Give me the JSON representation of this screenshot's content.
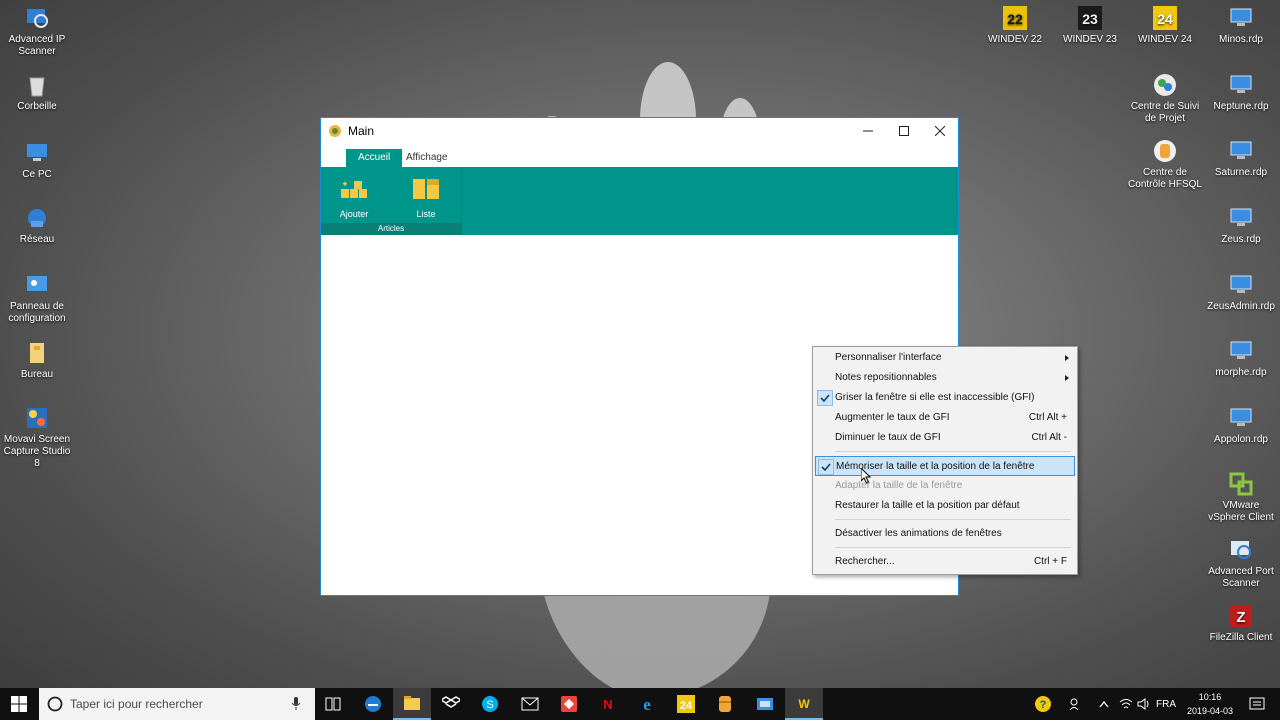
{
  "desktop_left": [
    {
      "label": "Advanced IP Scanner",
      "icon": "advanced-ip-scanner-icon"
    },
    {
      "label": "Corbeille",
      "icon": "recycle-bin-icon"
    },
    {
      "label": "Ce PC",
      "icon": "computer-icon"
    },
    {
      "label": "Réseau",
      "icon": "network-icon"
    },
    {
      "label": "Panneau de configuration",
      "icon": "control-panel-icon"
    },
    {
      "label": "Bureau",
      "icon": "folder-icon"
    },
    {
      "label": "Movavi Screen Capture Studio 8",
      "icon": "movavi-icon"
    }
  ],
  "desktop_right": [
    {
      "label": "WINDEV 22",
      "icon": "windev-22-icon"
    },
    {
      "label": "WINDEV 23",
      "icon": "windev-23-icon"
    },
    {
      "label": "WINDEV 24",
      "icon": "windev-24-icon"
    },
    {
      "label": "Minos.rdp",
      "icon": "rdp-icon"
    },
    {
      "label": "Centre de Suivi de Projet",
      "icon": "project-center-icon"
    },
    {
      "label": "Neptune.rdp",
      "icon": "rdp-icon"
    },
    {
      "label": "Centre de Contrôle HFSQL",
      "icon": "hfsql-icon"
    },
    {
      "label": "Saturne.rdp",
      "icon": "rdp-icon"
    },
    {
      "label": "Zeus.rdp",
      "icon": "rdp-icon"
    },
    {
      "label": "ZeusAdmin.rdp",
      "icon": "rdp-icon"
    },
    {
      "label": "morphe.rdp",
      "icon": "rdp-icon"
    },
    {
      "label": "Appolon.rdp",
      "icon": "rdp-icon"
    },
    {
      "label": "VMware vSphere Client",
      "icon": "vmware-icon"
    },
    {
      "label": "Advanced Port Scanner",
      "icon": "port-scanner-icon"
    },
    {
      "label": "FileZilla Client",
      "icon": "filezilla-icon"
    }
  ],
  "window": {
    "title": "Main",
    "tabs": [
      {
        "label": "Accueil",
        "active": true
      },
      {
        "label": "Affichage",
        "active": false
      }
    ],
    "group_label": "Articles",
    "buttons": [
      {
        "label": "Ajouter",
        "icon": "boxes-add-icon"
      },
      {
        "label": "Liste",
        "icon": "list-panel-icon"
      }
    ],
    "accent_color": "#00958a"
  },
  "context_menu": {
    "items": [
      {
        "label": "Personnaliser l'interface",
        "submenu": true
      },
      {
        "label": "Notes repositionnables",
        "submenu": true
      },
      {
        "label": "Griser la fenêtre si elle est inaccessible (GFI)",
        "checked": true
      },
      {
        "label": "Augmenter le taux de GFI",
        "shortcut": "Ctrl Alt +"
      },
      {
        "label": "Diminuer le taux de GFI",
        "shortcut": "Ctrl Alt -"
      },
      {
        "label": "Mémoriser la taille et la position de la fenêtre",
        "checked": true,
        "highlighted": true
      },
      {
        "label": "Adapter la taille de la fenêtre",
        "disabled": true
      },
      {
        "label": "Restaurer la taille et la position par défaut"
      },
      {
        "label": "Désactiver les animations de fenêtres"
      },
      {
        "label": "Rechercher...",
        "shortcut": "Ctrl + F"
      }
    ]
  },
  "taskbar": {
    "search_placeholder": "Taper ici pour rechercher",
    "language": "FRA",
    "time": "10:16",
    "date": "2019-04-03",
    "apps": [
      "task-view-icon",
      "edge-icon",
      "file-explorer-icon",
      "dropbox-icon",
      "skype-icon",
      "mail-icon",
      "anydesk-icon",
      "netflix-icon",
      "ie-icon",
      "windev-24-icon",
      "hfsql-icon",
      "network-tool-icon",
      "windev-icon"
    ]
  }
}
